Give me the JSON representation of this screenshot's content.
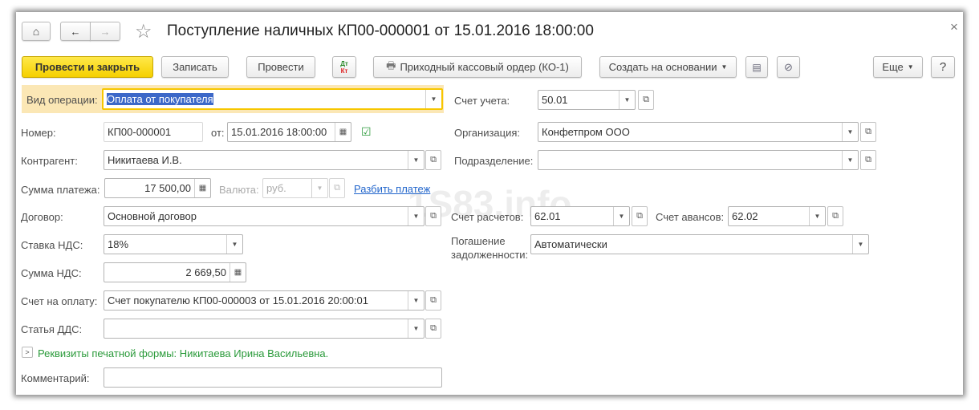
{
  "window": {
    "title": "Поступление наличных КП00-000001 от 15.01.2016 18:00:00",
    "close": "×"
  },
  "nav": {
    "home": "home-icon",
    "back": "←",
    "forward": "→",
    "star": "☆"
  },
  "toolbar": {
    "post_close": "Провести и закрыть",
    "save": "Записать",
    "post": "Провести",
    "dtkt_dt": "Дт",
    "dtkt_kt": "Кт",
    "print": "Приходный кассовый ордер (КО-1)",
    "create_based": "Создать на основании",
    "more": "Еще",
    "help": "?"
  },
  "form": {
    "operation_label": "Вид операции:",
    "operation": "Оплата от покупателя",
    "number_label": "Номер:",
    "number": "КП00-000001",
    "date_label": "от:",
    "date": "15.01.2016 18:00:00",
    "counterparty_label": "Контрагент:",
    "counterparty": "Никитаева И.В.",
    "amount_label": "Сумма платежа:",
    "amount": "17 500,00",
    "currency_label": "Валюта:",
    "currency": "руб.",
    "split_link": "Разбить платеж",
    "contract_label": "Договор:",
    "contract": "Основной договор",
    "vat_rate_label": "Ставка НДС:",
    "vat_rate": "18%",
    "vat_sum_label": "Сумма НДС:",
    "vat_sum": "2 669,50",
    "invoice_label": "Счет на оплату:",
    "invoice": "Счет покупателю КП00-000003 от 15.01.2016 20:00:01",
    "dds_label": "Статья ДДС:",
    "dds": "",
    "print_req": "Реквизиты печатной формы: Никитаева Ирина Васильевна.",
    "comment_label": "Комментарий:",
    "comment": "",
    "account_label": "Счет учета:",
    "account": "50.01",
    "org_label": "Организация:",
    "org": "Конфетпром ООО",
    "dept_label": "Подразделение:",
    "dept": "",
    "settle_label": "Счет расчетов:",
    "settle": "62.01",
    "advance_label": "Счет авансов:",
    "advance": "62.02",
    "repay_label_1": "Погашение",
    "repay_label_2": "задолженности:",
    "repay": "Автоматически"
  },
  "watermark": "1S83.info",
  "colors": {
    "primary_button": "#f5d000",
    "focus": "#f7c600",
    "link": "#2266cc",
    "green_text": "#2a9a3a",
    "selection": "#3c68c8"
  }
}
